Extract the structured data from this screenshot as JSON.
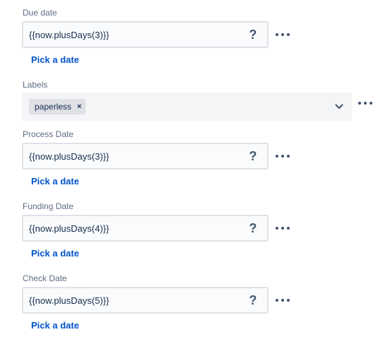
{
  "due_date": {
    "label": "Due date",
    "value": "{{now.plusDays(3)}}",
    "help": "?",
    "pick_label": "Pick a date"
  },
  "labels": {
    "label": "Labels",
    "tags": [
      "paperless"
    ],
    "remove_glyph": "×"
  },
  "process_date": {
    "label": "Process Date",
    "value": "{{now.plusDays(3)}}",
    "help": "?",
    "pick_label": "Pick a date"
  },
  "funding_date": {
    "label": "Funding Date",
    "value": "{{now.plusDays(4)}}",
    "help": "?",
    "pick_label": "Pick a date"
  },
  "check_date": {
    "label": "Check Date",
    "value": "{{now.plusDays(5)}}",
    "help": "?",
    "pick_label": "Pick a date"
  },
  "icons": {
    "more": "more-horizontal-icon",
    "help": "question-mark-icon",
    "chevron": "chevron-down-icon",
    "remove": "close-icon"
  },
  "colors": {
    "link": "#0052cc",
    "label": "#5e6c84",
    "field_border": "#dfe1e6",
    "field_bg": "#fafbfc",
    "select_bg": "#f4f5f7",
    "tag_bg": "#dfe1e6"
  }
}
